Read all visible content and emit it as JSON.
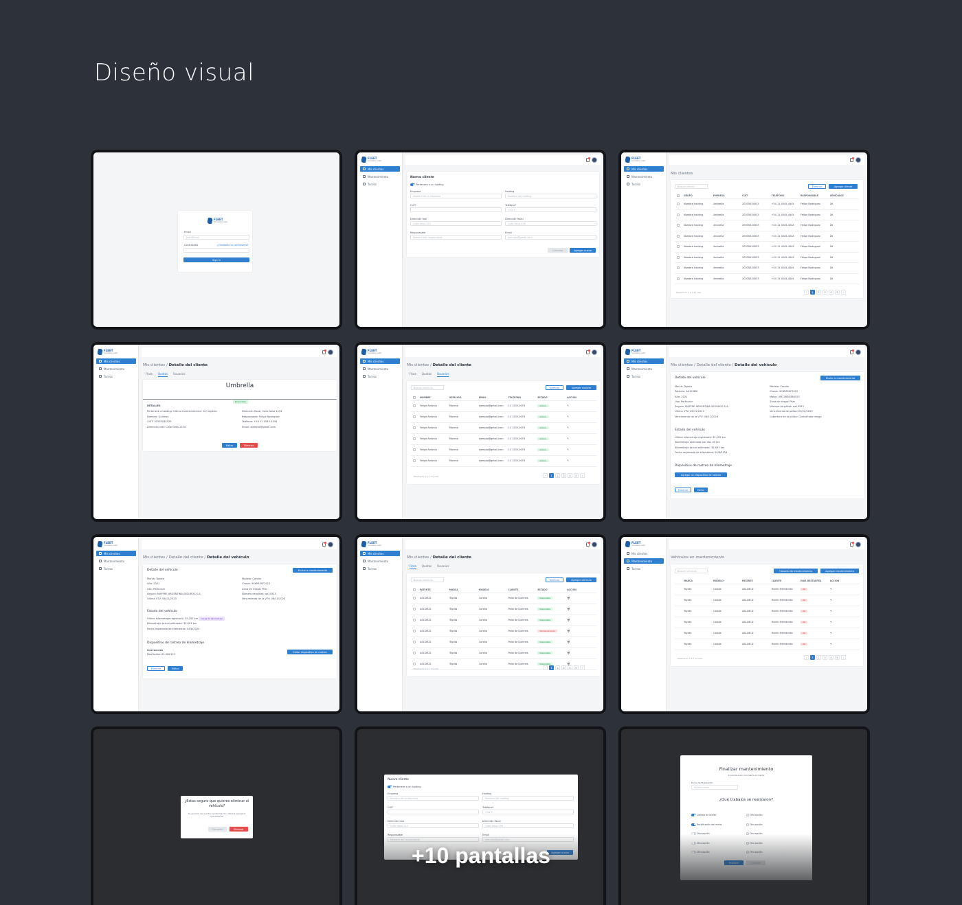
{
  "page": {
    "title": "Diseño visual",
    "more_screens": "+10 pantallas"
  },
  "brand": {
    "name": "FLEET",
    "sub": "Innovation Labs",
    "accent": "#2f7fd0",
    "background": "#2d323a"
  },
  "nav": {
    "items": [
      "Mis clientes",
      "Mantenimiento",
      "Turnos"
    ]
  },
  "login": {
    "email_label": "Email",
    "email_placeholder": "juan@mail",
    "password_label": "Contraseña",
    "forgot": "¿Olvidaste tu contraseña?",
    "submit": "Sign in"
  },
  "new_client": {
    "title": "Nuevo cliente",
    "holding_toggle": "Pertenece a un holding",
    "fields": [
      {
        "label": "Empresa",
        "placeholder": "Nombre de la empresa"
      },
      {
        "label": "Holding",
        "placeholder": "Nombre del holding"
      },
      {
        "label": "CUIT",
        "placeholder": ""
      },
      {
        "label": "Teléfono*",
        "placeholder": "+54 9"
      },
      {
        "label": "Dirección real",
        "placeholder": "Calle falsa 123"
      },
      {
        "label": "Dirección fiscal",
        "placeholder": "Calle falsa 456"
      },
      {
        "label": "Responsable",
        "placeholder": "Nombre del responsable"
      },
      {
        "label": "Email",
        "placeholder": "ejemplo@gmail.com"
      }
    ],
    "cancel": "Cancelar",
    "submit": "Agregar nuevo"
  },
  "clients": {
    "title": "Mis clientes",
    "search": "Buscar cliente",
    "delete": "Eliminar",
    "add": "Agregar cliente",
    "columns": [
      "GRUPO",
      "EMPRESA",
      "CUIT",
      "TELÉFONO",
      "RESPONSABLE",
      "VEHÍCULOS"
    ],
    "row": [
      "Nombre holding",
      "Umbrella",
      "20335034533",
      "+54 11 4545-4545",
      "Felipe Rodriguez",
      "26"
    ],
    "row_count": 8,
    "footer": "Mostrando 1 a 7 de 100",
    "pages": [
      "‹",
      "1",
      "2",
      "3",
      "4",
      "5",
      "›"
    ]
  },
  "client_detail": {
    "crumb_parent": "Mis clientes",
    "crumb_current": "Detalle del cliente",
    "tabs": [
      "Flota",
      "Quotas",
      "Usuarios"
    ],
    "company": "Umbrella",
    "status": "Disponible",
    "section": "DETALLES",
    "left": [
      "Pertenece a holding: Último mantenimiento: 12/ registro",
      "Nombre: Quilmes",
      "CUIT: 30335034533",
      "Dirección real: Calle falsa 1234"
    ],
    "right": [
      "Dirección fiscal: Calle falsa 1234",
      "Responsable: Felipe Rodriguez",
      "Teléfono: +54 11 4545-4545",
      "Email: ejemplo@gmail.com"
    ],
    "edit": "Editar",
    "remove": "Eliminar"
  },
  "users": {
    "search": "Buscar vehículo",
    "delete": "Eliminar",
    "add": "Agregar usuario",
    "columns": [
      "NOMBRE",
      "APELLIDO",
      "EMAIL",
      "TELÉFONO",
      "ESTADO",
      "ACCIÓN"
    ],
    "row": [
      "Felipe Antonio",
      "Moreno",
      "ejemplo@gmail.com",
      "11 1233-0078",
      "Activo"
    ],
    "row_count": 6,
    "footer": "Mostrando 1 a 7 de 100"
  },
  "vehicle_detail": {
    "crumb_current": "Detalle del vehículo",
    "title": "Detalle del vehículo",
    "send": "Enviar a mantenimiento",
    "left": [
      "Marca: Toyota",
      "Patente: AA123BB",
      "Año: 2021",
      "Uso: Particular",
      "Seguro: MAPFRE ARGENTINA SEGUROS S.A.",
      "Última VTV: 06/11/2023",
      "Vencimiento de la VTV: 06/11/2023"
    ],
    "left_short": [
      "Marca: Toyota",
      "Año: 2021",
      "Uso: Particular",
      "Seguro: MAPFRE ARGENTINA SEGUROS S.A.",
      "Última VTV: 06/11/2023"
    ],
    "right": [
      "Modelo: Corolla",
      "Chasis: 9C6PA5SF2012",
      "Motor: 4M12BSB3B6523",
      "Zona de riesgo: Pilar",
      "Número de póliza: ax19323",
      "Vencimiento de póliza: 20/12/2023",
      "Cobertura de la póliza: Contra todo riesgo"
    ],
    "right_short": [
      "Modelo: Corolla",
      "Chasis: 9C6PA5SF2012",
      "Zona de riesgo: Pilar",
      "Número de póliza: ax19323",
      "Vencimiento de la VTV: 06/11/2023"
    ],
    "state_title": "Estado del vehículo",
    "state": [
      "Último kilometraje registrado: 35,255 km",
      "Kilometraje estimado por día: 45 km",
      "Kilometraje actual estimado: 35,693 km",
      "Fecha registrada de kilómetros: 04/8/2024"
    ],
    "state_tag": "Carga de kilometraje",
    "tracker_title": "Dispositivo de rastreo de kilometraje",
    "tracker_add": "Agregar un dispositivo de rastreo",
    "tracker_name": "MAXTRACKER",
    "tracker_id": "MaxTracker ID: ABC123",
    "tracker_edit": "Editar dispositivo de rastreo",
    "delete": "Eliminar",
    "edit": "Editar"
  },
  "fleet": {
    "search": "Buscar vehículo",
    "delete": "Eliminar",
    "add": "Agregar vehículo",
    "columns": [
      "PATENTE",
      "MARCA",
      "MODELO",
      "CLIENTE",
      "ESTADO",
      "ACCIÓN"
    ],
    "rows": [
      [
        "AS128CD",
        "Toyota",
        "Corolla",
        "Pollo de Quilmes",
        "Disponible",
        "green"
      ],
      [
        "AS128CD",
        "Toyota",
        "Corolla",
        "Pollo de Quilmes",
        "Disponible",
        "green"
      ],
      [
        "AS128CD",
        "Toyota",
        "Corolla",
        "Pollo de Quilmes",
        "Disponible",
        "green"
      ],
      [
        "AS128CD",
        "Toyota",
        "Corolla",
        "Pollo de Quilmes",
        "Mantenimiento",
        "pink"
      ],
      [
        "AS128CD",
        "Toyota",
        "Corolla",
        "Pollo de Quilmes",
        "Disponible",
        "green"
      ],
      [
        "AS128CD",
        "Toyota",
        "Corolla",
        "Pollo de Quilmes",
        "Disponible",
        "green"
      ],
      [
        "AS128CD",
        "Toyota",
        "Corolla",
        "Pollo de Quilmes",
        "Disponible",
        "green"
      ]
    ],
    "footer": "Mostrando 1 a 7 de 100"
  },
  "maintenance": {
    "title": "Vehículos en mantenimiento",
    "search": "Buscar vehículo",
    "history": "Historial de mantenimiento",
    "add": "Agregar mantenimiento",
    "columns": [
      "MARCA",
      "MODELO",
      "PATENTE",
      "CLIENTE",
      "DÍAS RESTANTES",
      "ACCIÓN"
    ],
    "row": [
      "Toyota",
      "Corolla",
      "AS128CD",
      "Martín Hernández",
      "30"
    ],
    "row_count": 6,
    "footer": "Mostrando 1 a 7 de 100"
  },
  "delete_modal": {
    "title": "¿Estas seguro que quieres eliminar el vehículo?",
    "body": "Su guardar esa perder la información, deberá agregarlo nuevamente.",
    "cancel": "Cancelar",
    "confirm": "Eliminar"
  },
  "finish_modal": {
    "title": "Finalizar mantenimiento",
    "subtitle": "Se enviará por una alerta al cliente",
    "date_label": "Fecha de finalización",
    "date_placeholder": "dd/mm/aaaa",
    "question": "¿Qué trabajos se realizaron?",
    "left": [
      "Cambio de aceite",
      "Rectificación del motor",
      "Otra opción",
      "Otra opción",
      "Otra opción"
    ],
    "right": [
      "Otra opción",
      "Otra opción",
      "Otra opción",
      "Otra opción",
      "Otra opción"
    ],
    "submit": "Finalizar",
    "cancel": "Cancelar"
  }
}
